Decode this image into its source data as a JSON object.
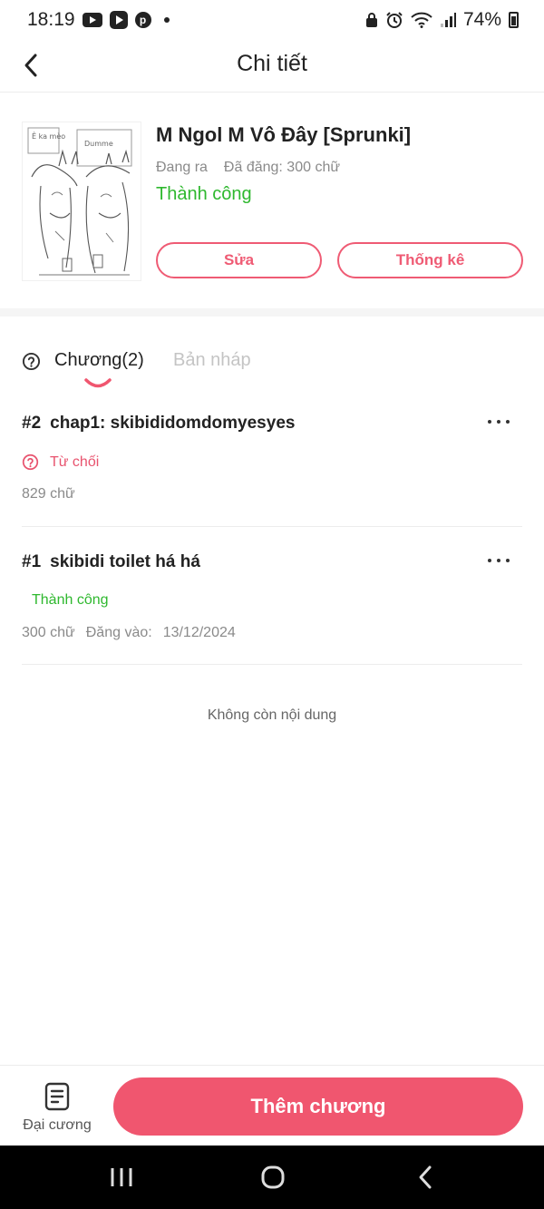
{
  "status_bar": {
    "time": "18:19",
    "battery": "74%",
    "icons": [
      "youtube-icon",
      "play-store-icon",
      "pinterest-icon",
      "notification-dot-icon",
      "alarm-icon",
      "wifi-icon",
      "signal-icon",
      "battery-icon"
    ]
  },
  "header": {
    "title": "Chi tiết",
    "back_icon": "chevron-left-icon"
  },
  "book": {
    "title": "M Ngol M Vô Đây [Sprunki]",
    "state": "Đang ra",
    "word_count": "Đã đăng: 300 chữ",
    "status": "Thành công",
    "edit_label": "Sửa",
    "stats_label": "Thống kê",
    "cover_text_1": "Ê ka mèo",
    "cover_text_2": "Dumme"
  },
  "tabs": {
    "help_icon": "question-circle-icon",
    "chapters_label": "Chương(2)",
    "drafts_label": "Bản nháp",
    "active": "chapters"
  },
  "chapters": [
    {
      "number": "#2",
      "title": "chap1: skibididomdomyesyes",
      "status": "Từ chối",
      "status_icon": "question-circle-icon",
      "words": "829 chữ",
      "posted_label": "",
      "posted_date": ""
    },
    {
      "number": "#1",
      "title": "skibidi toilet há há",
      "status": "Thành công",
      "words": "300 chữ",
      "posted_label": "Đăng vào:",
      "posted_date": "13/12/2024"
    }
  ],
  "end_text": "Không còn nội dung",
  "bottom": {
    "outline_label": "Đại cương",
    "outline_icon": "document-list-icon",
    "add_label": "Thêm chương"
  },
  "colors": {
    "accent": "#f0566f",
    "success": "#2eb82e",
    "rejected": "#e8536e"
  }
}
